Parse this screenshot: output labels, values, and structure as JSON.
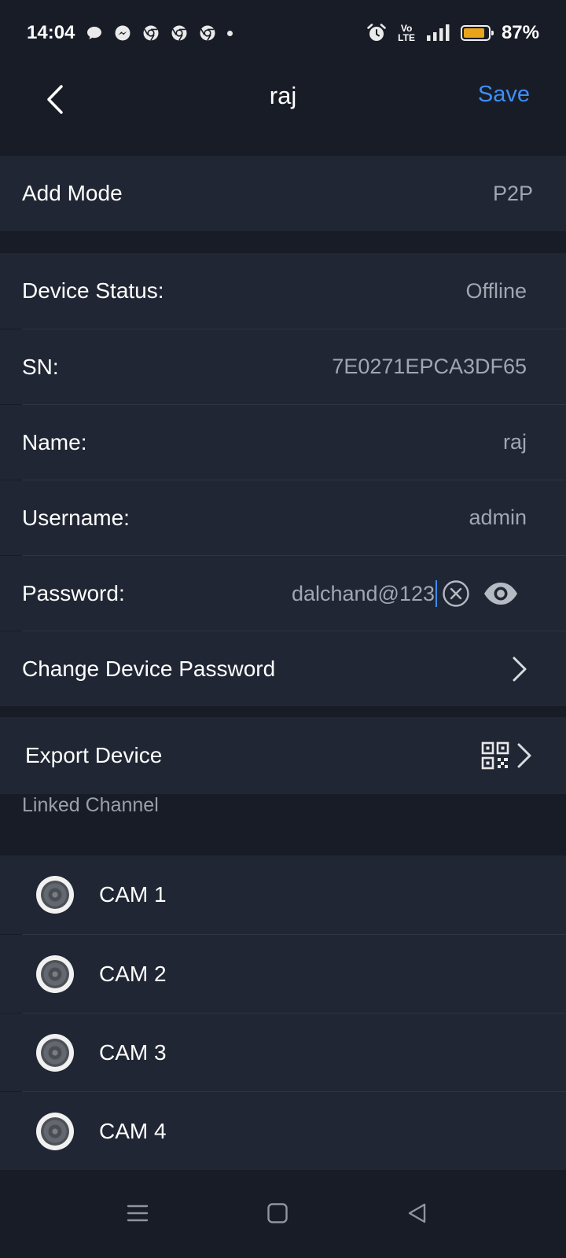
{
  "status_bar": {
    "time": "14:04",
    "network_top": "Vo",
    "network_bottom": "LTE",
    "battery_percent": "87%",
    "battery_level": 0.87,
    "notification_icons": [
      "chat-bubble-icon",
      "messenger-icon",
      "chrome-icon",
      "chrome-icon",
      "chrome-icon",
      "dot-icon"
    ]
  },
  "header": {
    "title": "raj",
    "save_label": "Save"
  },
  "add_mode": {
    "label": "Add Mode",
    "value": "P2P"
  },
  "device_info": {
    "status_label": "Device Status:",
    "status_value": "Offline",
    "sn_label": "SN:",
    "sn_value": "7E0271EPCA3DF65",
    "name_label": "Name:",
    "name_value": "raj",
    "username_label": "Username:",
    "username_value": "admin",
    "password_label": "Password:",
    "password_value": "dalchand@123",
    "change_password_label": "Change Device Password"
  },
  "export": {
    "label": "Export Device"
  },
  "linked_channel": {
    "title": "Linked Channel",
    "channels": [
      "CAM 1",
      "CAM 2",
      "CAM 3",
      "CAM 4"
    ]
  },
  "colors": {
    "background": "#181c26",
    "row": "#202633",
    "accent": "#3d8ff5",
    "battery": "#e8a41b",
    "secondary_text": "#a1a6b1"
  }
}
